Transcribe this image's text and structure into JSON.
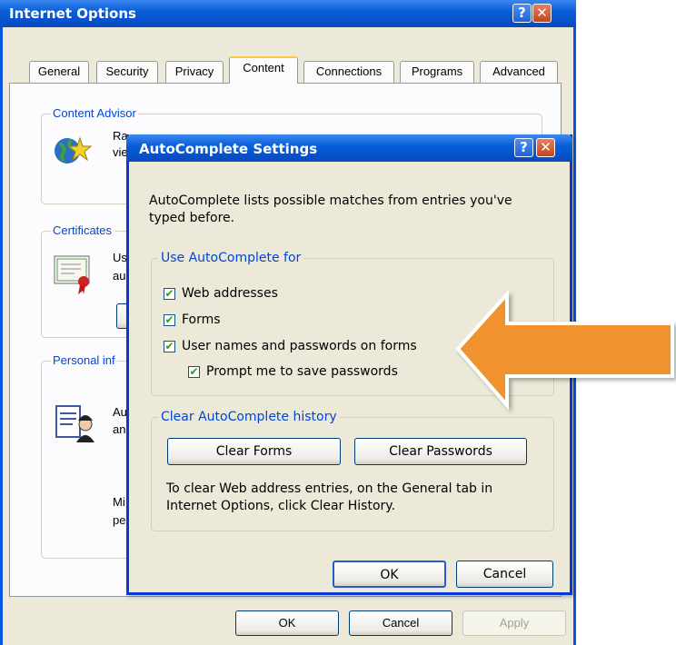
{
  "outer_window": {
    "title": "Internet Options",
    "help_glyph": "?",
    "close_glyph": "✕",
    "tabs": [
      {
        "label": "General"
      },
      {
        "label": "Security"
      },
      {
        "label": "Privacy"
      },
      {
        "label": "Content",
        "active": true
      },
      {
        "label": "Connections"
      },
      {
        "label": "Programs"
      },
      {
        "label": "Advanced"
      }
    ],
    "content_advisor": {
      "label": "Content Advisor",
      "text_fragment_1": "Ra",
      "text_fragment_2": "vie"
    },
    "certificates": {
      "label": "Certificates",
      "text_fragment_1": "Us",
      "text_fragment_2": "au"
    },
    "personal_info": {
      "label": "Personal inf",
      "text_fragment_1": "Au",
      "text_fragment_2": "an",
      "text_fragment_3": "Mi",
      "text_fragment_4": "pe"
    },
    "buttons": {
      "ok": "OK",
      "cancel": "Cancel",
      "apply": "Apply"
    }
  },
  "dialog": {
    "title": "AutoComplete Settings",
    "help_glyph": "?",
    "close_glyph": "✕",
    "description_line1": "AutoComplete lists possible matches from entries you've",
    "description_line2": "typed before.",
    "use_group_label": "Use AutoComplete for",
    "options": [
      {
        "label": "Web addresses",
        "checked": true
      },
      {
        "label": "Forms",
        "checked": true
      },
      {
        "label": "User names and passwords on forms",
        "checked": true
      },
      {
        "label": "Prompt me to save passwords",
        "checked": true
      }
    ],
    "clear_group_label": "Clear AutoComplete history",
    "clear_forms_button": "Clear Forms",
    "clear_passwords_button": "Clear Passwords",
    "clear_note_line1": "To clear Web address entries, on the General tab in",
    "clear_note_line2": "Internet Options, click Clear History.",
    "ok_button": "OK",
    "cancel_button": "Cancel"
  },
  "colors": {
    "titlebar": "#0553d0",
    "window_bg": "#ece9d8",
    "group_label_blue": "#0046d5",
    "arrow_fill": "#f0932f"
  },
  "icons": {
    "content_advisor_icon": "globe-star-icon",
    "certificates_icon": "certificate-icon",
    "personal_info_icon": "profile-card-icon",
    "callout_arrow": "left-arrow-icon"
  }
}
